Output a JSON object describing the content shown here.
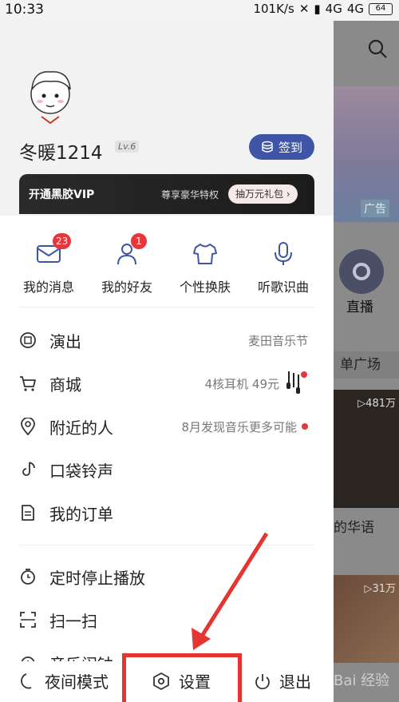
{
  "status_bar": {
    "time": "10:33",
    "network_speed": "101K/s",
    "signal_text_1": "4G",
    "signal_text_2": "4G",
    "battery": "64"
  },
  "background_app": {
    "ad_label": "广告",
    "live_label": "直播",
    "tag_label": "单广场",
    "play_count_1": "▷481万",
    "caption": "的华语",
    "play_count_2": "▷31万",
    "watermark": "Bai 经验"
  },
  "profile": {
    "username": "冬暖1214",
    "level": "Lv.6",
    "checkin_label": "签到"
  },
  "vip": {
    "title": "开通黑胶VIP",
    "subtitle": "尊享豪华特权",
    "gift_label": "抽万元礼包 ›"
  },
  "quick_actions": [
    {
      "label": "我的消息",
      "badge": "23"
    },
    {
      "label": "我的好友",
      "badge": "1"
    },
    {
      "label": "个性换肤",
      "badge": ""
    },
    {
      "label": "听歌识曲",
      "badge": ""
    }
  ],
  "menu": {
    "shows": {
      "label": "演出",
      "extra": "麦田音乐节"
    },
    "mall": {
      "label": "商城",
      "extra": "4核耳机 49元"
    },
    "nearby": {
      "label": "附近的人",
      "extra": "8月发现音乐更多可能"
    },
    "ringtone": {
      "label": "口袋铃声"
    },
    "orders": {
      "label": "我的订单"
    },
    "timer": {
      "label": "定时停止播放"
    },
    "scan": {
      "label": "扫一扫"
    },
    "alarm": {
      "label": "音乐闹钟"
    }
  },
  "bottom_bar": {
    "night_mode": "夜间模式",
    "settings": "设置",
    "exit": "退出"
  },
  "colors": {
    "accent": "#3f56a6",
    "badge_red": "#e8353a",
    "highlight_red": "#e53532"
  }
}
